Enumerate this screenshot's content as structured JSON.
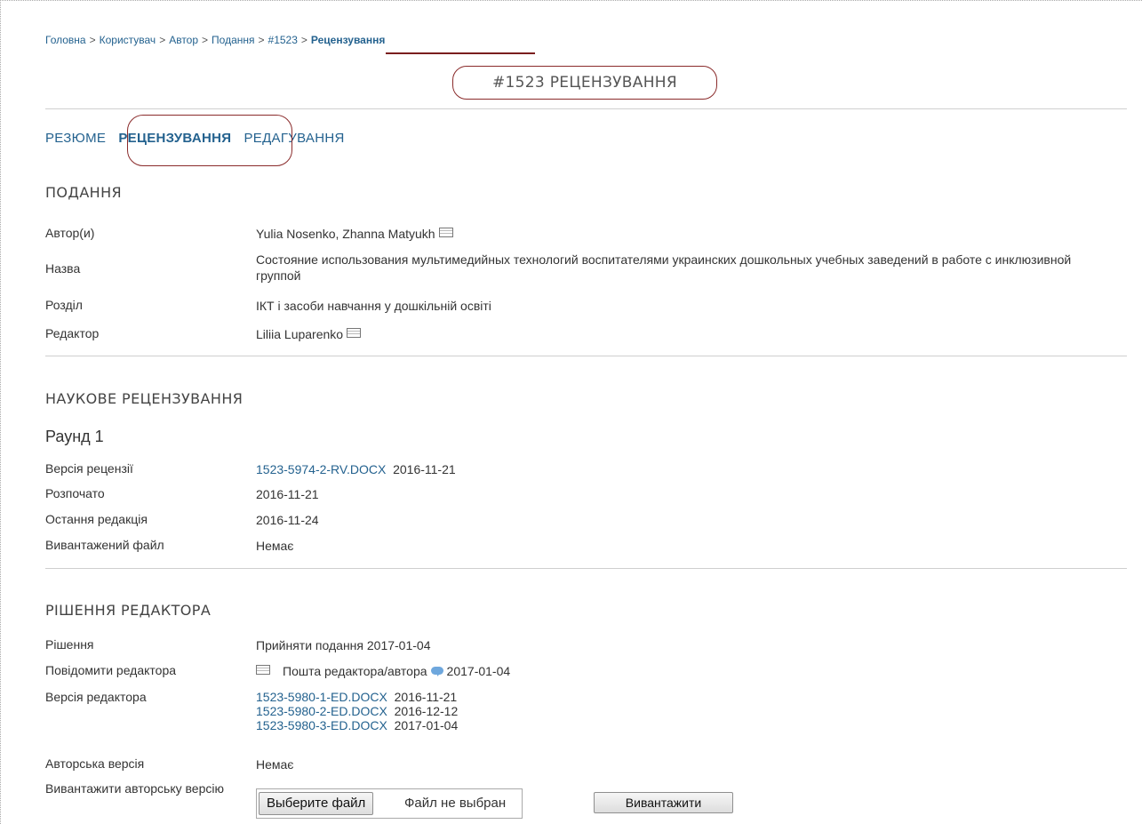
{
  "breadcrumb": {
    "items": [
      "Головна",
      "Користувач",
      "Автор",
      "Подання",
      "#1523"
    ],
    "separator": ">",
    "current": "Рецензування"
  },
  "page_title": "#1523 РЕЦЕНЗУВАННЯ",
  "tabs": [
    {
      "label": "РЕЗЮМЕ",
      "active": false
    },
    {
      "label": "РЕЦЕНЗУВАННЯ",
      "active": true
    },
    {
      "label": "РЕДАГУВАННЯ",
      "active": false
    }
  ],
  "submission": {
    "title": "ПОДАННЯ",
    "authors_label": "Автор(и)",
    "authors_value": "Yulia Nosenko, Zhanna Matyukh",
    "name_label": "Назва",
    "name_value": "Состояние использования мультимедийных технологий воспитателями украинских дошкольных учебных заведений в работе с инклюзивной группой",
    "section_label": "Розділ",
    "section_value": "ІКТ і засоби навчання у дошкільній освіті",
    "editor_label": "Редактор",
    "editor_value": "Liliia Luparenko"
  },
  "peer_review": {
    "title": "НАУКОВЕ РЕЦЕНЗУВАННЯ",
    "round": "Раунд 1",
    "review_version_label": "Версія рецензії",
    "review_version_file": "1523-5974-2-RV.DOCX",
    "review_version_date": "2016-11-21",
    "started_label": "Розпочато",
    "started_value": "2016-11-21",
    "last_modified_label": "Остання редакція",
    "last_modified_value": "2016-11-24",
    "uploaded_file_label": "Вивантажений файл",
    "uploaded_file_value": "Немає"
  },
  "editor_decision": {
    "title": "РІШЕННЯ РЕДАКТОРА",
    "decision_label": "Рішення",
    "decision_value": "Прийняти подання 2017-01-04",
    "notify_label": "Повідомити редактора",
    "notify_value": "Пошта редактора/автора",
    "notify_date": "2017-01-04",
    "editor_version_label": "Версія редактора",
    "editor_versions": [
      {
        "file": "1523-5980-1-ED.DOCX",
        "date": "2016-11-21"
      },
      {
        "file": "1523-5980-2-ED.DOCX",
        "date": "2016-12-12"
      },
      {
        "file": "1523-5980-3-ED.DOCX",
        "date": "2017-01-04"
      }
    ],
    "author_version_label": "Авторська версія",
    "author_version_value": "Немає",
    "upload_label": "Вивантажити авторську версію",
    "choose_file_button": "Выберите файл",
    "no_file_text": "Файл не выбран",
    "upload_button": "Вивантажити"
  },
  "colors": {
    "link": "#24628f",
    "annotation": "#8a2b2b",
    "divider": "#cfcfcf"
  }
}
